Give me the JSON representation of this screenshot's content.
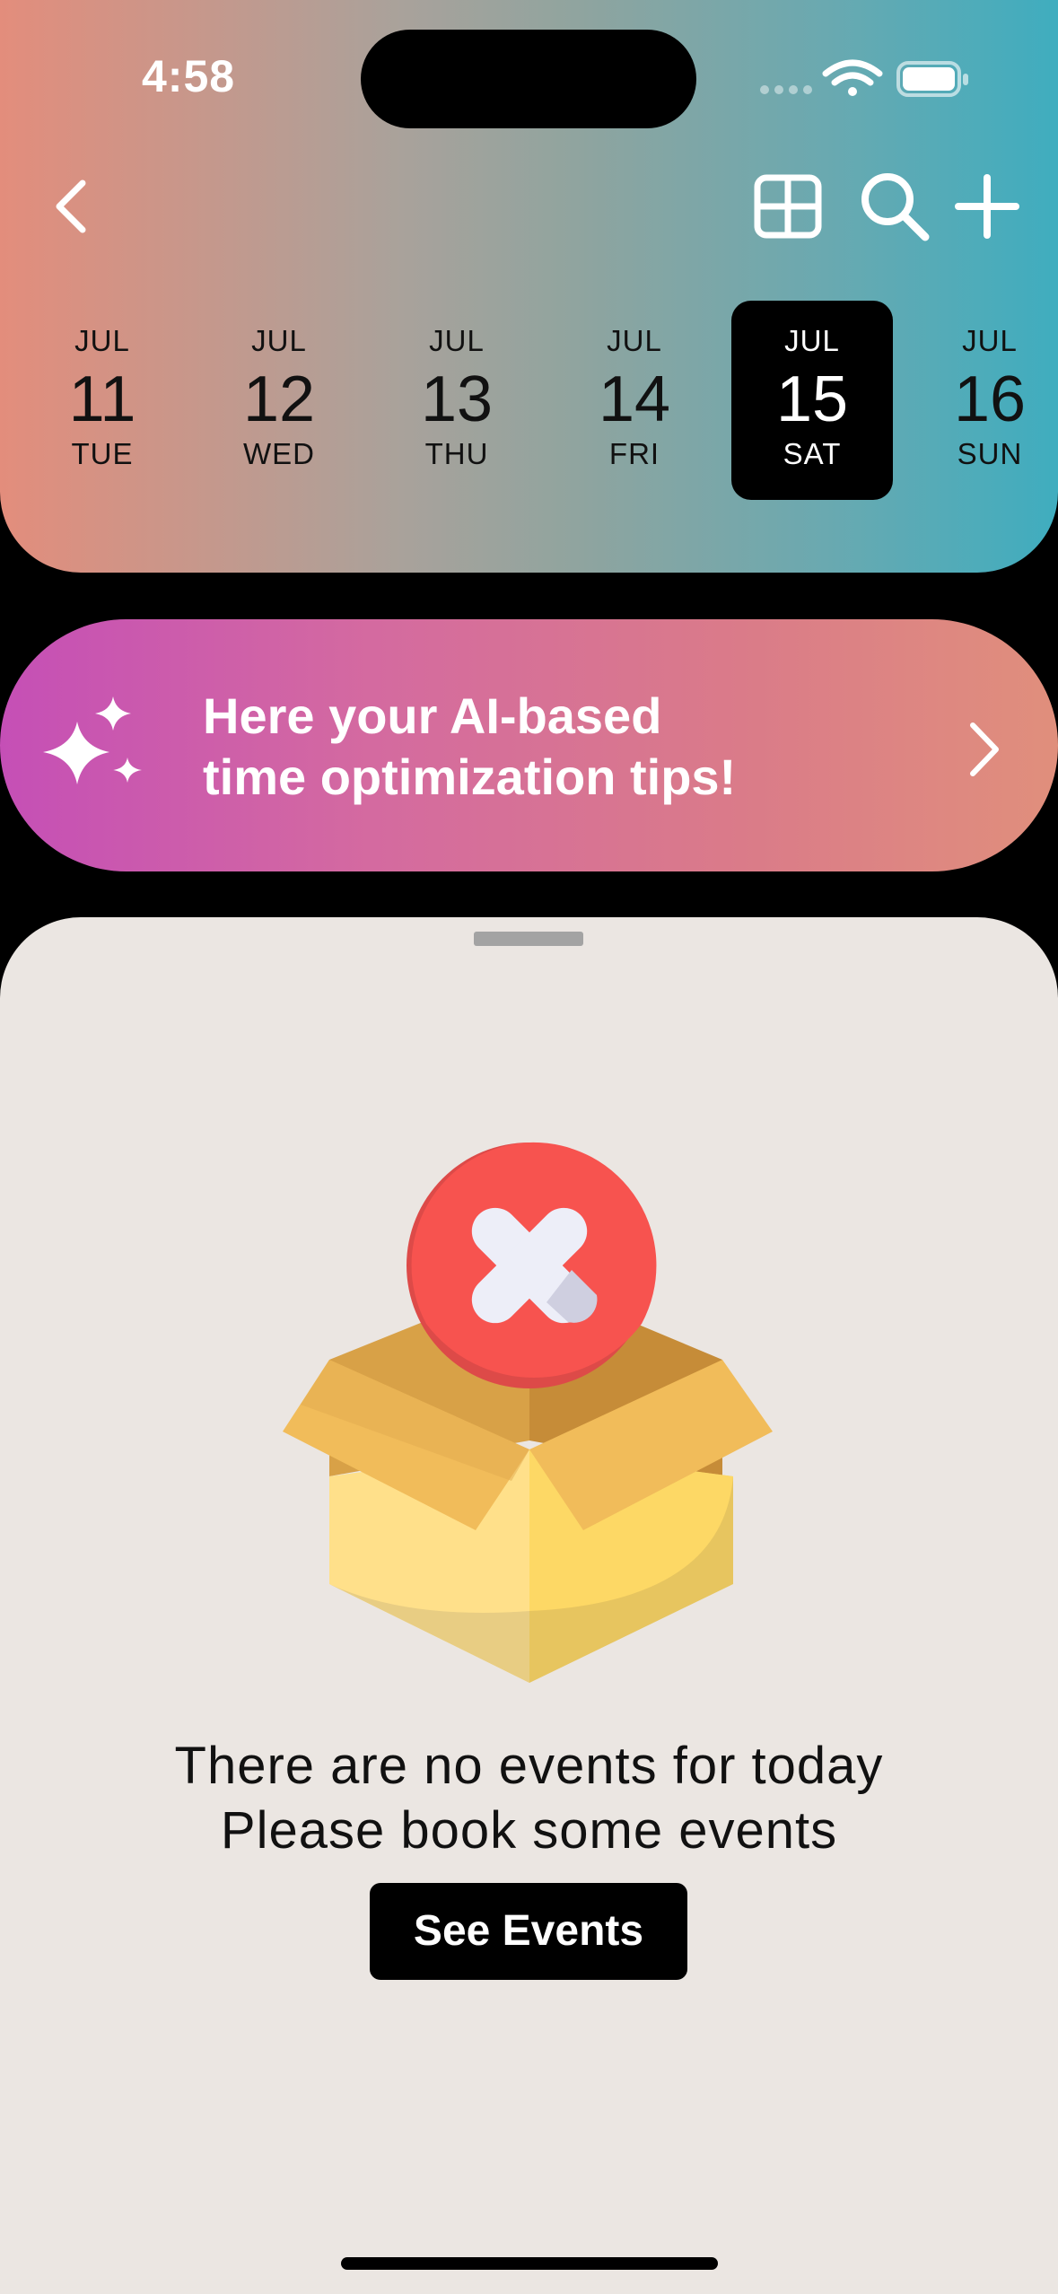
{
  "status_bar": {
    "time": "4:58"
  },
  "header": {
    "icons": [
      "chevron-left-icon",
      "grid-icon",
      "search-icon",
      "plus-icon"
    ]
  },
  "days": [
    {
      "month": "JUL",
      "day": "11",
      "weekday": "TUE",
      "selected": false
    },
    {
      "month": "JUL",
      "day": "12",
      "weekday": "WED",
      "selected": false
    },
    {
      "month": "JUL",
      "day": "13",
      "weekday": "THU",
      "selected": false
    },
    {
      "month": "JUL",
      "day": "14",
      "weekday": "FRI",
      "selected": false
    },
    {
      "month": "JUL",
      "day": "15",
      "weekday": "SAT",
      "selected": true
    },
    {
      "month": "JUL",
      "day": "16",
      "weekday": "SUN",
      "selected": false
    }
  ],
  "tips_banner": {
    "line1": "Here your AI-based",
    "line2": "time optimization tips!"
  },
  "empty_state": {
    "line1": "There are no events for today",
    "line2": "Please book some events",
    "button_label": "See Events"
  },
  "colors": {
    "header_gradient_start": "#e38d7c",
    "header_gradient_end": "#3fadbf",
    "banner_gradient_start": "#c54fb6",
    "banner_gradient_end": "#e08f7c",
    "sheet_background": "#ebe6e2",
    "selected_day": "#000000"
  }
}
